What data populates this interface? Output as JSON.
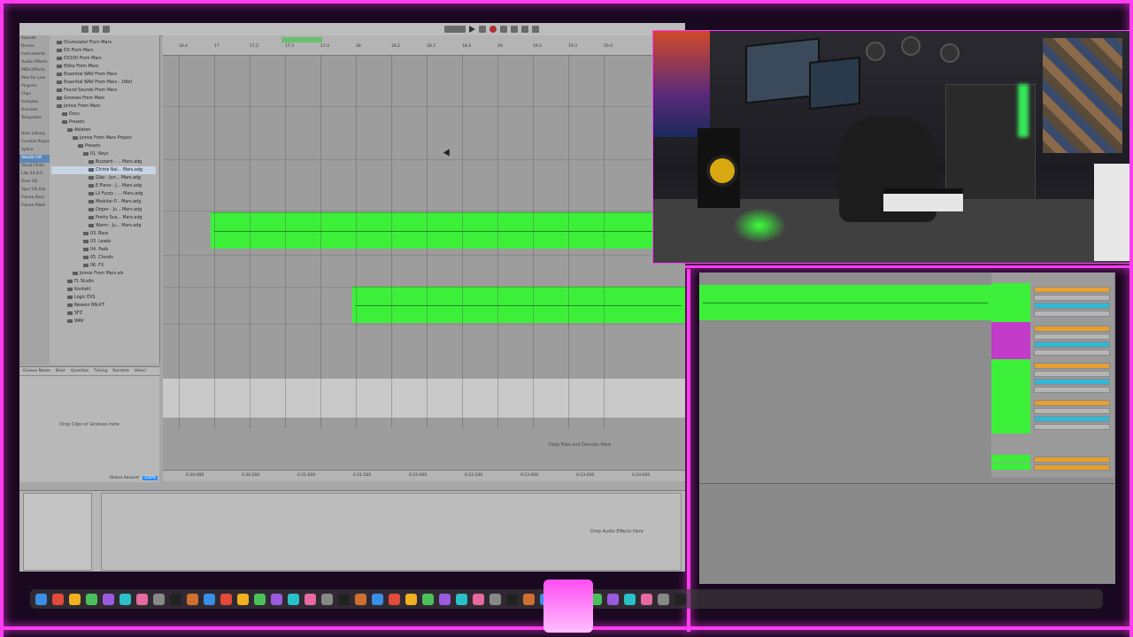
{
  "colors": {
    "clip_green": "#3cf03a",
    "neon_pink": "#ff3cf0",
    "track_magenta": "#c23ac8",
    "accent_blue": "#2b8cff"
  },
  "browser": {
    "sidebar": [
      "Sounds",
      "Drums",
      "Instruments",
      "Audio Effects",
      "MIDI Effects",
      "Max for Live",
      "Plug-ins",
      "Clips",
      "Samples",
      "Grooves",
      "Templates",
      "",
      "User Library",
      "Current Project",
      "Splice",
      "AbeStr.f.M",
      "Vocal Chain",
      "Lite 24.0.5",
      "Ocar GS",
      "Spur UX Gal",
      "Future Bass",
      "Future Plant"
    ],
    "sidebar_selected": 15,
    "tree": [
      {
        "label": "Drumulator From Mars",
        "depth": 1
      },
      {
        "label": "DX From Mars",
        "depth": 1
      },
      {
        "label": "DX100 From Mars",
        "depth": 1
      },
      {
        "label": "Elkko From Mars",
        "depth": 1
      },
      {
        "label": "Essential WAV From Mars",
        "depth": 1
      },
      {
        "label": "Essential WAV From Mars - 16bit",
        "depth": 1
      },
      {
        "label": "Found Sounds From Mars",
        "depth": 1
      },
      {
        "label": "Grooves From Mars",
        "depth": 1
      },
      {
        "label": "Jomox From Mars",
        "depth": 1
      },
      {
        "label": "Docs",
        "depth": 2
      },
      {
        "label": "Presets",
        "depth": 2
      },
      {
        "label": "Ableton",
        "depth": 3
      },
      {
        "label": "Jomox From Mars Project",
        "depth": 4
      },
      {
        "label": "Presets",
        "depth": 5
      },
      {
        "label": "01. Keys",
        "depth": 6
      },
      {
        "label": "Buzzard - ... Mars.adg",
        "depth": 7
      },
      {
        "label": "Chime Nel... Mars.adg",
        "depth": 7
      },
      {
        "label": "Glas - Jun... Mars.adg",
        "depth": 7
      },
      {
        "label": "E Piano - J... Mars.adg",
        "depth": 7
      },
      {
        "label": "Lil Fuzzy - ... Mars.adg",
        "depth": 7
      },
      {
        "label": "Modular P... Mars.adg",
        "depth": 7
      },
      {
        "label": "Organ - Ju... Mars.adg",
        "depth": 7
      },
      {
        "label": "Pretty Sca... Mars.adg",
        "depth": 7
      },
      {
        "label": "Warm - Ju... Mars.adg",
        "depth": 7
      },
      {
        "label": "03. Bass",
        "depth": 6
      },
      {
        "label": "03. Leads",
        "depth": 6
      },
      {
        "label": "04. Pads",
        "depth": 6
      },
      {
        "label": "05. Chords",
        "depth": 6
      },
      {
        "label": "06. FX",
        "depth": 6
      },
      {
        "label": "Jomox From Mars.als",
        "depth": 4
      },
      {
        "label": "FL Studio",
        "depth": 3
      },
      {
        "label": "Kontakt",
        "depth": 3
      },
      {
        "label": "Logic EXS",
        "depth": 3
      },
      {
        "label": "Reason NN-XT",
        "depth": 3
      },
      {
        "label": "SFZ",
        "depth": 3
      },
      {
        "label": "WAV",
        "depth": 3
      }
    ],
    "tree_selected": 16
  },
  "groove": {
    "headers": [
      "Groove Name",
      "Base",
      "Quantize",
      "Timing",
      "Random",
      "Veloci"
    ],
    "drop_text": "Drop Clips or Grooves here",
    "global_label": "Global Amount",
    "global_value": "100%"
  },
  "arrangement": {
    "bars": [
      "16.4",
      "17",
      "17.2",
      "17.3",
      "17.4",
      "18",
      "18.2",
      "18.3",
      "18.4",
      "19",
      "19.2",
      "19.3",
      "19.4"
    ],
    "times": [
      "0:20:000",
      "0:20:500",
      "0:21:000",
      "0:21:500",
      "0:22:000",
      "0:22:500",
      "0:23:000",
      "0:23:500",
      "0:24:000"
    ],
    "drop_devices": "Drop Files and Devices Here"
  },
  "device": {
    "drop_audio": "Drop Audio Effects Here"
  },
  "dock_icons": [
    "finder-icon",
    "launchpad-icon",
    "safari-icon",
    "messages-icon",
    "mail-icon",
    "maps-icon",
    "photos-icon",
    "facetime-icon",
    "calendar-icon",
    "notes-icon",
    "reminders-icon",
    "tv-icon",
    "music-icon",
    "podcasts-icon",
    "app-store-icon",
    "settings-icon",
    "chrome-icon",
    "ableton-icon",
    "live-icon",
    "terminal-icon",
    "splice-icon",
    "audio-icon",
    "discord-icon",
    "obs-icon",
    "native-access-icon",
    "spotify-icon",
    "logic-icon",
    "capture-icon",
    "video-icon",
    "preview-icon",
    "ilok-icon",
    "kontakt-icon",
    "pages-icon",
    "numbers-icon",
    "keynote-icon",
    "xcode-icon",
    "calculator-icon",
    "activity-icon",
    "trash-icon"
  ]
}
